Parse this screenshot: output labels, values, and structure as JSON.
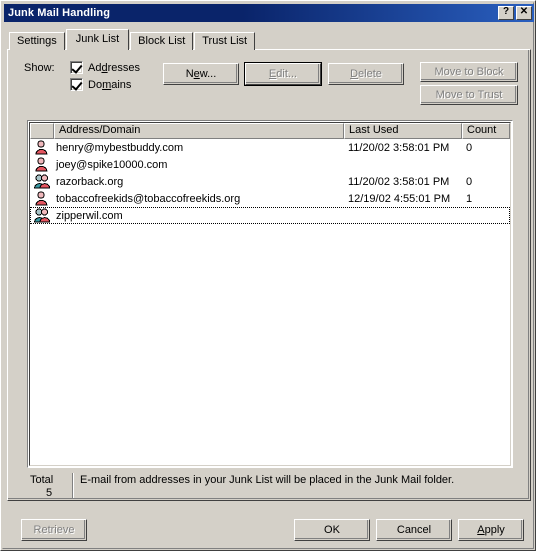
{
  "window": {
    "title": "Junk Mail Handling",
    "help_button": "?",
    "close_button": "✕"
  },
  "tabs": [
    {
      "label": "Settings",
      "selected": false
    },
    {
      "label": "Junk List",
      "selected": true
    },
    {
      "label": "Block List",
      "selected": false
    },
    {
      "label": "Trust List",
      "selected": false
    }
  ],
  "show": {
    "label": "Show:",
    "options": [
      {
        "label_pre": "Ad",
        "label_accel": "d",
        "label_post": "resses",
        "checked": true
      },
      {
        "label_pre": "Do",
        "label_accel": "m",
        "label_post": "ains",
        "checked": true
      }
    ]
  },
  "actions": {
    "new": {
      "label_pre": "N",
      "label_accel": "e",
      "label_post": "w...",
      "disabled": false,
      "focused": false
    },
    "edit": {
      "label_pre": "",
      "label_accel": "E",
      "label_post": "dit...",
      "disabled": true,
      "focused": true
    },
    "delete": {
      "label_pre": "",
      "label_accel": "D",
      "label_post": "elete",
      "disabled": true,
      "focused": false
    },
    "move_to_block": {
      "label": "Move to Block",
      "disabled": true
    },
    "move_to_trust": {
      "label": "Move to Trust",
      "disabled": true
    }
  },
  "list": {
    "columns": [
      {
        "key": "icon",
        "label": ""
      },
      {
        "key": "name",
        "label": "Address/Domain"
      },
      {
        "key": "date",
        "label": "Last Used"
      },
      {
        "key": "count",
        "label": "Count"
      }
    ],
    "rows": [
      {
        "icon": "person-icon",
        "name": "henry@mybestbuddy.com",
        "date": "11/20/02 3:58:01 PM",
        "count": "0",
        "focused": false
      },
      {
        "icon": "person-icon",
        "name": "joey@spike10000.com",
        "date": "",
        "count": "",
        "focused": false
      },
      {
        "icon": "people-icon",
        "name": "razorback.org",
        "date": "11/20/02 3:58:01 PM",
        "count": "0",
        "focused": false
      },
      {
        "icon": "person-icon",
        "name": "tobaccofreekids@tobaccofreekids.org",
        "date": "12/19/02 4:55:01 PM",
        "count": "1",
        "focused": false
      },
      {
        "icon": "people-icon",
        "name": "zipperwil.com",
        "date": "",
        "count": "",
        "focused": true
      }
    ]
  },
  "footer": {
    "total_label": "Total",
    "total_value": "5",
    "description": "E-mail from addresses in your Junk List will be placed in the Junk Mail folder."
  },
  "dialog_buttons": {
    "retrieve": {
      "label": "Retrieve",
      "disabled": true
    },
    "ok": {
      "label": "OK",
      "disabled": false
    },
    "cancel": {
      "label": "Cancel",
      "disabled": false
    },
    "apply": {
      "label_pre": "",
      "label_accel": "A",
      "label_post": "pply",
      "disabled": false
    }
  },
  "colors": {
    "titlebar_start": "#0a246a",
    "titlebar_end": "#2a5fbf",
    "dialog_face": "#d4d0c8",
    "list_background": "#ffffff",
    "disabled_text": "#808080",
    "icon_person": "#e8a0a8",
    "icon_person_dark": "#d04858",
    "icon_people_secondary": "#40a0a8"
  }
}
